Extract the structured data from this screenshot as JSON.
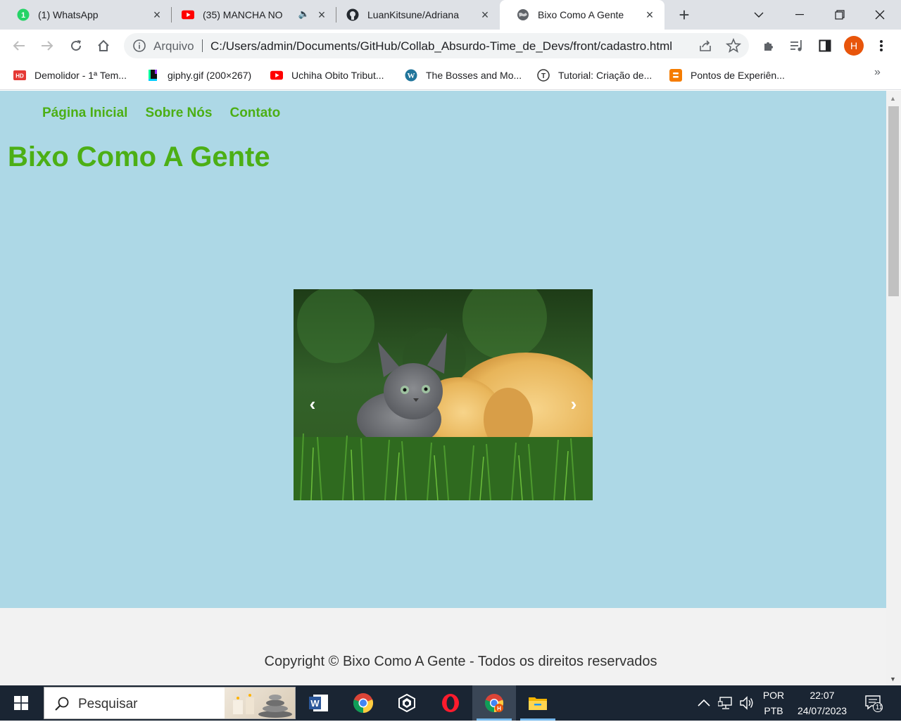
{
  "browser": {
    "tabs": [
      {
        "title": "(1) WhatsApp",
        "icon": "whatsapp-icon"
      },
      {
        "title": "(35) MANCHA NO",
        "icon": "youtube-icon"
      },
      {
        "title": "LuanKitsune/Adriana",
        "icon": "github-icon"
      },
      {
        "title": "Bixo Como A Gente",
        "icon": "globe-icon",
        "active": true
      }
    ],
    "omnibox": {
      "label": "Arquivo",
      "url": "C:/Users/admin/Documents/GitHub/Collab_Absurdo-Time_de_Devs/front/cadastro.html"
    },
    "profile_initial": "H",
    "bookmarks": [
      {
        "label": "Demolidor - 1ª Tem...",
        "icon": "hd-icon"
      },
      {
        "label": "giphy.gif (200×267)",
        "icon": "giphy-icon"
      },
      {
        "label": "Uchiha Obito Tribut...",
        "icon": "youtube-icon"
      },
      {
        "label": "The Bosses and Mo...",
        "icon": "wordpress-icon"
      },
      {
        "label": "Tutorial: Criação de...",
        "icon": "tutorial-icon"
      },
      {
        "label": "Pontos de Experiên...",
        "icon": "blogger-icon"
      }
    ],
    "bookmarks_more": "»"
  },
  "page": {
    "nav": [
      "Página Inicial",
      "Sobre Nós",
      "Contato"
    ],
    "title": "Bixo Como A Gente",
    "carousel": {
      "prev": "‹",
      "next": "›"
    },
    "footer": "Copyright © Bixo Como A Gente - Todos os direitos reservados"
  },
  "taskbar": {
    "search_placeholder": "Pesquisar",
    "language": "POR",
    "layout": "PTB",
    "time": "22:07",
    "date": "24/07/2023",
    "notifications": "11"
  },
  "colors": {
    "page_bg": "#add8e6",
    "accent_green": "#4caf15",
    "footer_bg": "#f2f2f2",
    "taskbar_bg": "#1a2533"
  }
}
